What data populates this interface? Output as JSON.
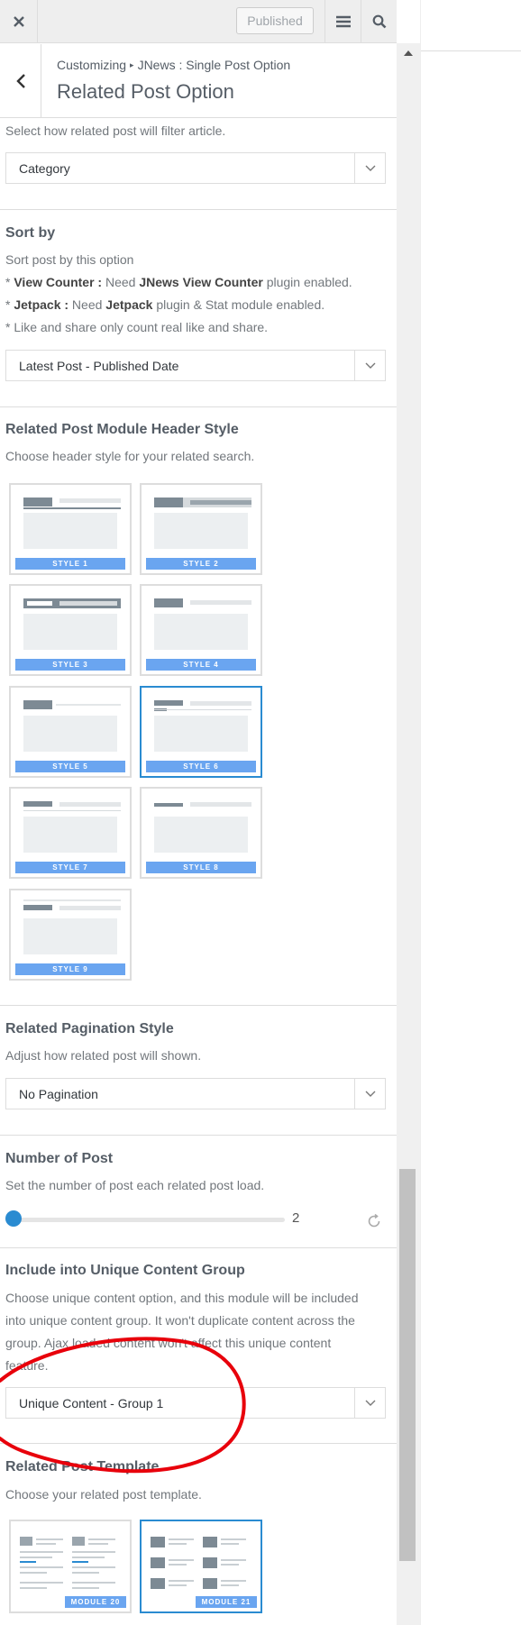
{
  "header": {
    "published_label": "Published",
    "close_icon": "close-icon",
    "menu_icon": "hamburger-icon",
    "search_icon": "search-icon"
  },
  "title_bar": {
    "breadcrumb_root": "Customizing",
    "breadcrumb_separator": "▸",
    "breadcrumb_section": "JNews : Single Post Option",
    "title": "Related Post Option"
  },
  "filter": {
    "description": "Select how related post will filter article.",
    "value": "Category"
  },
  "sort": {
    "title": "Sort by",
    "desc1": "Sort post by this option",
    "line2_prefix": "* ",
    "line2_b1": "View Counter :",
    "line2_mid": " Need ",
    "line2_b2": "JNews View Counter",
    "line2_suffix": " plugin enabled.",
    "line3_prefix": "* ",
    "line3_b1": "Jetpack :",
    "line3_mid": " Need ",
    "line3_b2": "Jetpack",
    "line3_suffix": " plugin & Stat module enabled.",
    "line4": "* Like and share only count real like and share.",
    "value": "Latest Post - Published Date"
  },
  "header_style": {
    "title": "Related Post Module Header Style",
    "description": "Choose header style for your related search.",
    "styles": [
      "STYLE 1",
      "STYLE 2",
      "STYLE 3",
      "STYLE 4",
      "STYLE 5",
      "STYLE 6",
      "STYLE 7",
      "STYLE 8",
      "STYLE 9"
    ],
    "selected": "STYLE 6"
  },
  "pagination": {
    "title": "Related Pagination Style",
    "description": "Adjust how related post will shown.",
    "value": "No Pagination"
  },
  "number_of_post": {
    "title": "Number of Post",
    "description": "Set the number of post each related post load.",
    "value": "2",
    "level_fraction": 0.0
  },
  "unique_content": {
    "title": "Include into Unique Content Group",
    "desc1": "Choose unique content option, and this module will be included",
    "desc2": "into unique content group. It won't duplicate content across the",
    "desc3": "group. Ajax loaded content won't affect this unique content",
    "desc4": "feature.",
    "value": "Unique Content - Group 1"
  },
  "template": {
    "title": "Related Post Template",
    "description": "Choose your related post template.",
    "modules": [
      "MODULE 20",
      "MODULE 21"
    ],
    "selected": "MODULE 21"
  },
  "colors": {
    "accent": "#2a8bd1",
    "thumb_label": "#6aa5f0",
    "annotation": "#e8000b"
  }
}
